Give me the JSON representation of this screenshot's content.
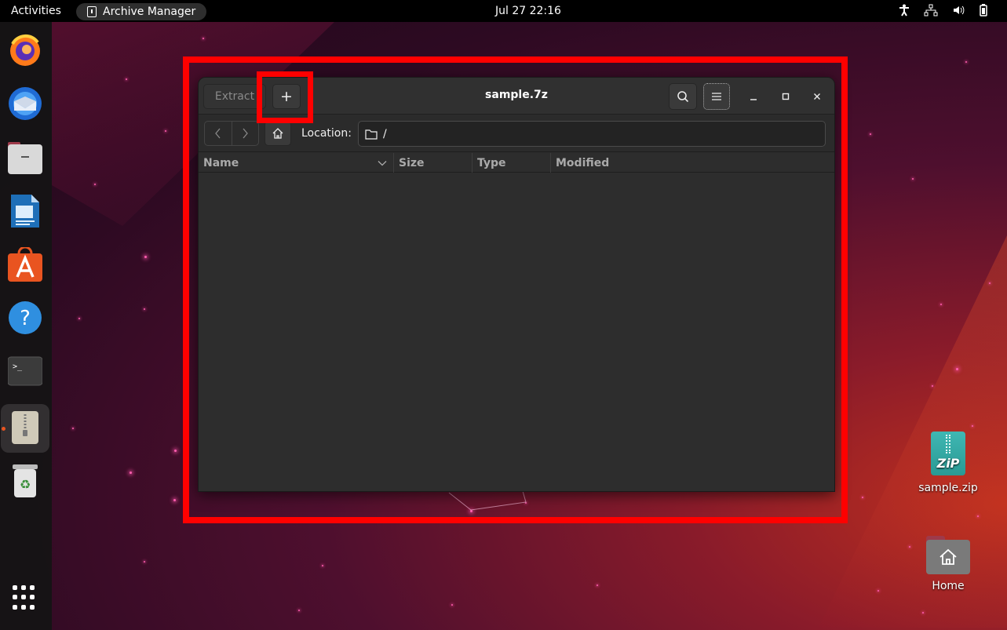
{
  "topbar": {
    "activities": "Activities",
    "app_name": "Archive Manager",
    "clock": "Jul 27  22:16",
    "tray_icons": [
      "accessibility-icon",
      "network-icon",
      "volume-icon",
      "battery-icon"
    ]
  },
  "dock": {
    "items": [
      {
        "name": "Firefox",
        "icon": "firefox-icon"
      },
      {
        "name": "Thunderbird",
        "icon": "thunderbird-icon"
      },
      {
        "name": "Files",
        "icon": "files-icon"
      },
      {
        "name": "LibreOffice Writer",
        "icon": "writer-icon"
      },
      {
        "name": "Ubuntu Software",
        "icon": "software-icon"
      },
      {
        "name": "Help",
        "icon": "help-icon"
      },
      {
        "name": "Terminal",
        "icon": "terminal-icon"
      },
      {
        "name": "Archive Manager",
        "icon": "archive-icon",
        "active": true
      },
      {
        "name": "Trash",
        "icon": "trash-icon"
      }
    ],
    "show_apps": "apps-grid-icon"
  },
  "window": {
    "title": "sample.7z",
    "extract_label": "Extract",
    "add_label": "+",
    "location_label": "Location:",
    "location_value": "/",
    "columns": [
      "Name",
      "Size",
      "Type",
      "Modified"
    ],
    "rows": []
  },
  "desktop": {
    "icons": [
      {
        "label": "sample.zip",
        "icon_text": "ZiP"
      },
      {
        "label": "Home"
      }
    ]
  },
  "colors": {
    "highlight": "#ff0000",
    "accent": "#e95420",
    "window_bg": "#2d2d2d"
  }
}
